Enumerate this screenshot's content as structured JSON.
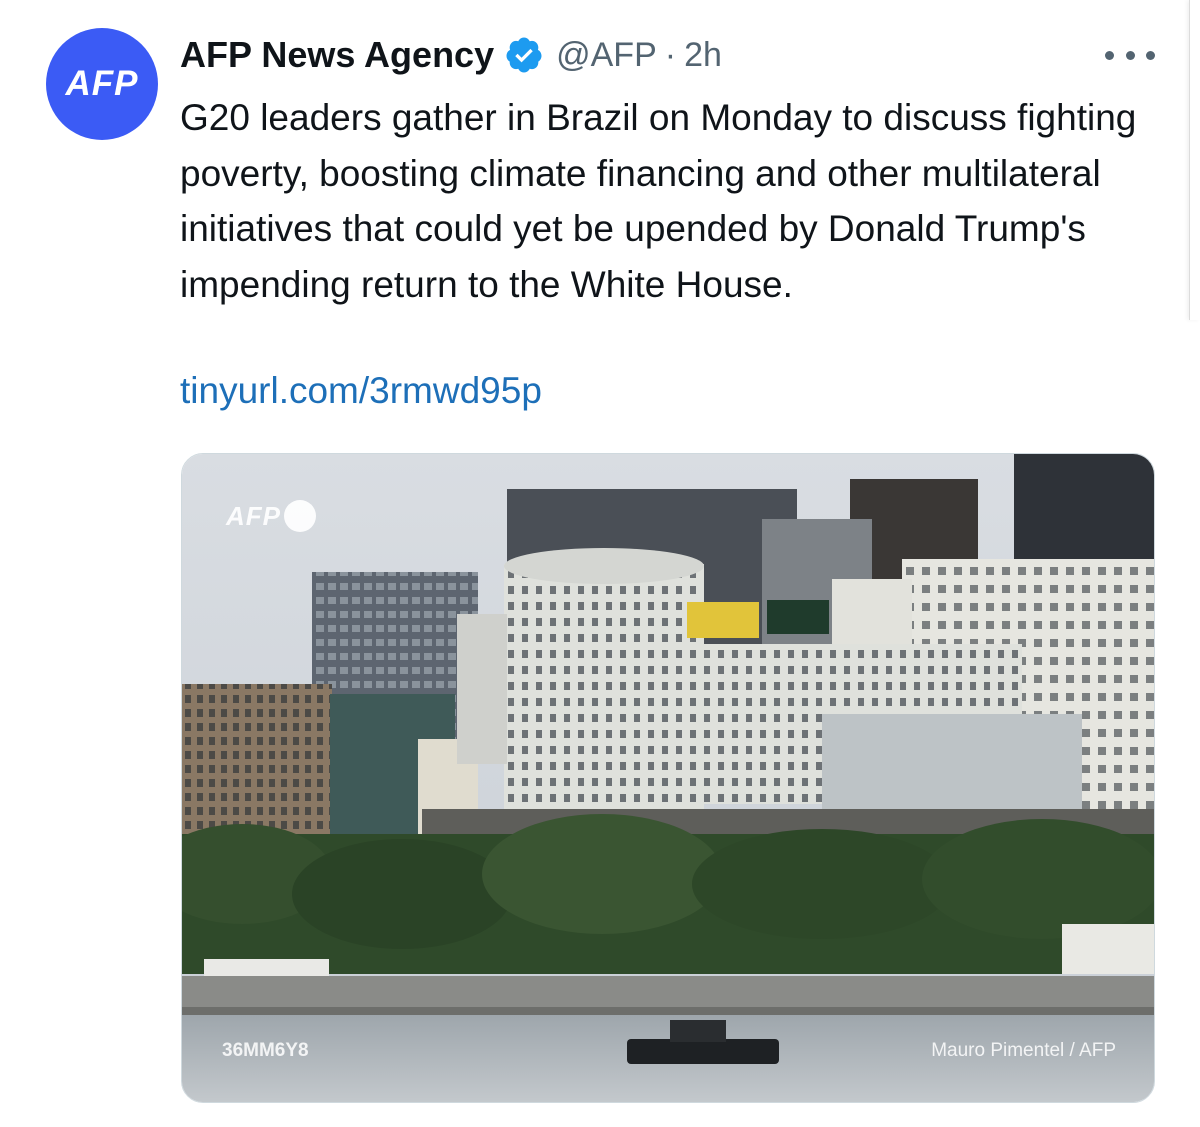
{
  "tweet": {
    "avatar_text": "AFP",
    "display_name": "AFP News Agency",
    "handle": "@AFP",
    "separator": "·",
    "time": "2h",
    "text": "G20 leaders gather in Brazil on Monday to discuss fighting poverty, boosting climate financing and other multilateral initiatives that could yet be upended by Donald Trump's impending return to the White House.",
    "link": "tinyurl.com/3rmwd95p"
  },
  "media": {
    "watermark_logo": "AFP",
    "code": "36MM6Y8",
    "credit": "Mauro Pimentel / AFP"
  },
  "icons": {
    "verified": "verified-badge-icon",
    "more": "more-options-icon"
  },
  "colors": {
    "avatar_bg": "#3b5bf5",
    "verified": "#1d9bf0",
    "link": "#1d6fb8",
    "text": "#0f1419",
    "secondary": "#536471"
  }
}
